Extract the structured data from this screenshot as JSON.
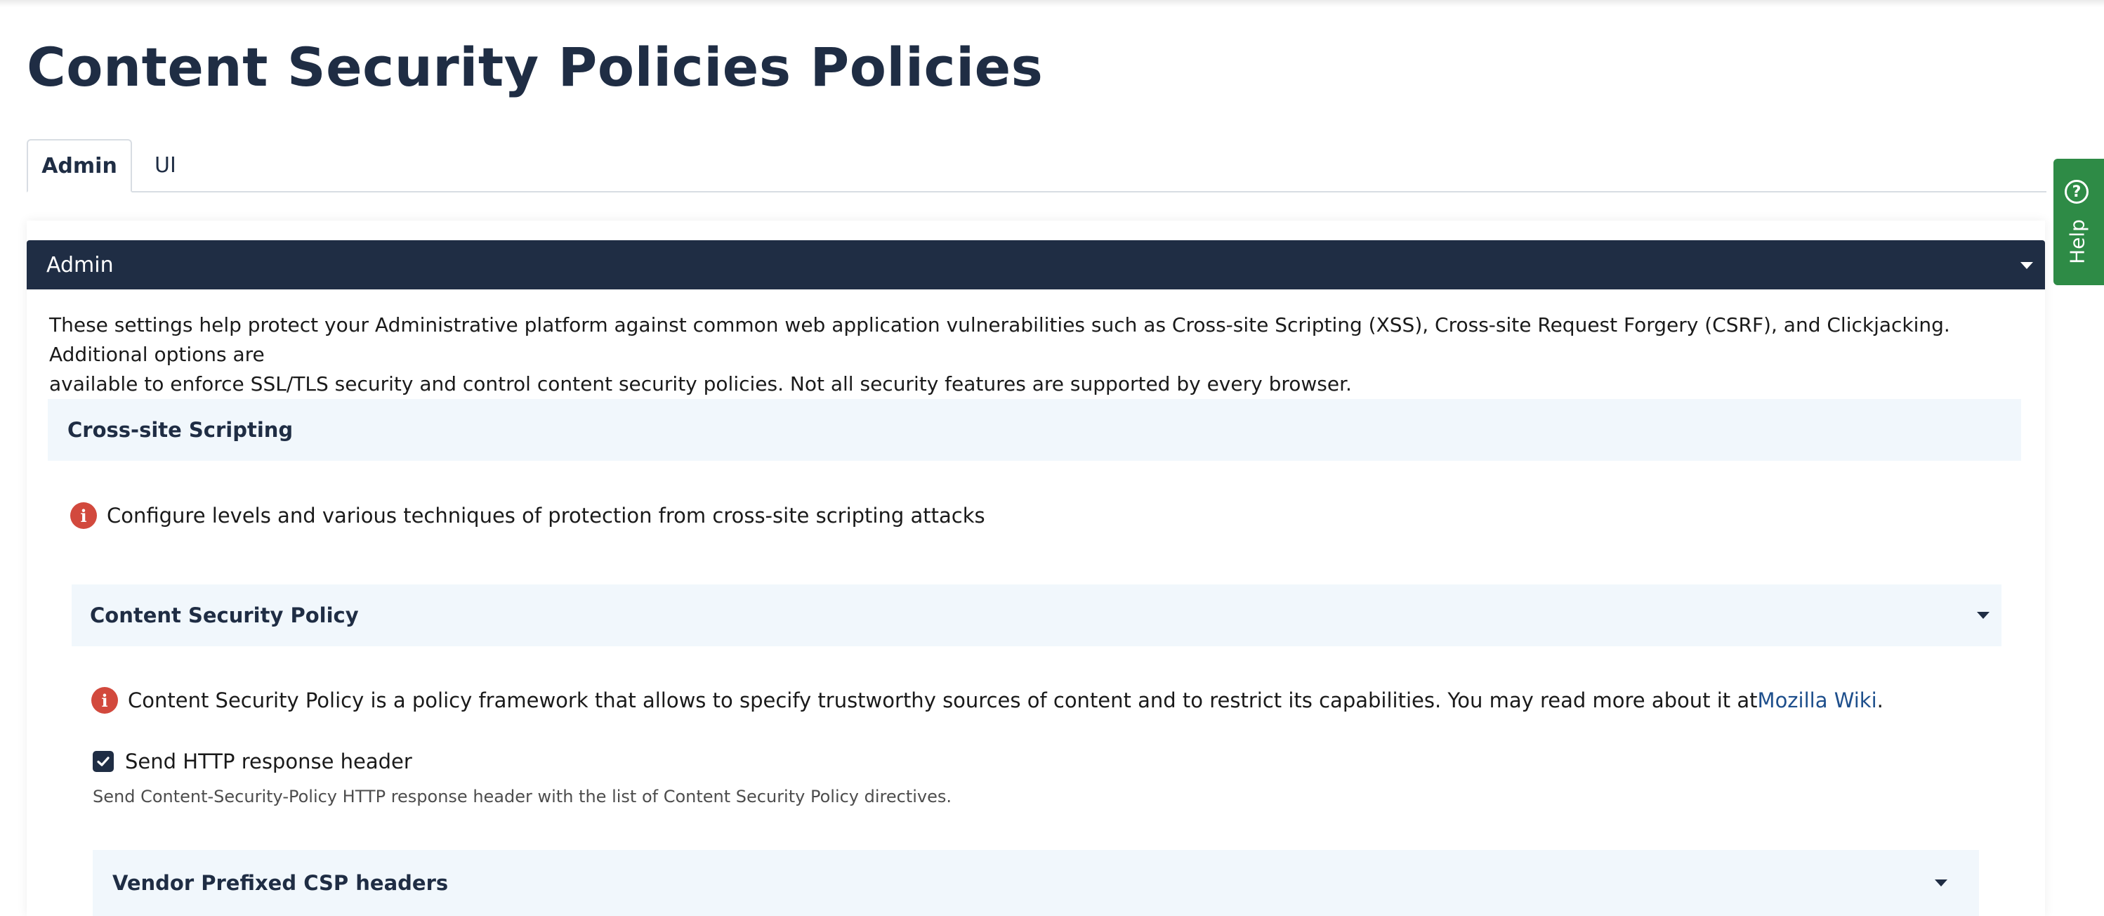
{
  "page": {
    "title": "Content Security Policies Policies"
  },
  "tabs": [
    {
      "label": "Admin",
      "active": true
    },
    {
      "label": "UI",
      "active": false
    }
  ],
  "panel": {
    "header": "Admin",
    "intro_line1": "These settings help protect your Administrative platform against common web application vulnerabilities such as Cross-site Scripting (XSS), Cross-site Request Forgery (CSRF), and Clickjacking. Additional options are",
    "intro_line2": "available to enforce SSL/TLS security and control content security policies. Not all security features are supported by every browser."
  },
  "xss_section": {
    "title": "Cross-site Scripting",
    "info": "Configure levels and various techniques of protection from cross-site scripting attacks"
  },
  "csp_section": {
    "title": "Content Security Policy",
    "info_text": "Content Security Policy is a policy framework that allows to specify trustworthy sources of content and to restrict its capabilities. You may read more about it at",
    "info_link": "Mozilla Wiki",
    "info_end": ".",
    "checkbox_label": "Send HTTP response header",
    "checkbox_checked": true,
    "checkbox_hint": "Send Content-Security-Policy HTTP response header with the list of Content Security Policy directives."
  },
  "vendor_section": {
    "title": "Vendor Prefixed CSP headers"
  },
  "help": {
    "label": "Help",
    "color": "#2e8b46"
  },
  "colors": {
    "header_bg": "#1f2d44",
    "section_bg": "#f1f7fc",
    "info_icon": "#d2493d"
  }
}
